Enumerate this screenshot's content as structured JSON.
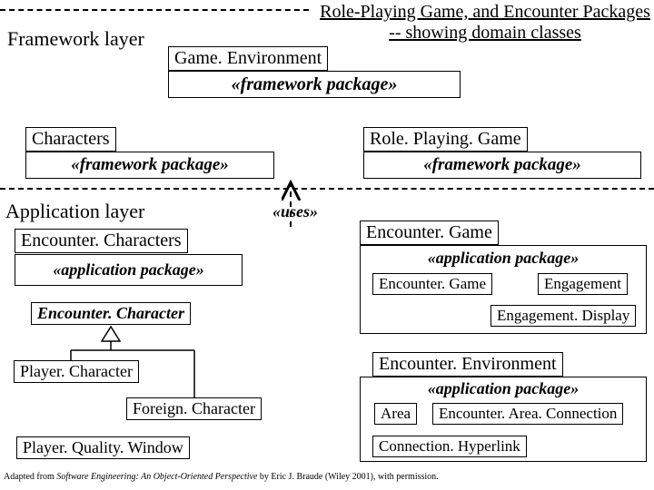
{
  "header": {
    "title_line1": "Role-Playing Game, and Encounter Packages",
    "title_line2": "-- showing domain classes"
  },
  "layers": {
    "framework": "Framework layer",
    "application": "Application layer"
  },
  "stereotypes": {
    "framework": "«framework package»",
    "application": "«application package»",
    "uses": "«uses»"
  },
  "packages": {
    "game_environment": "Game. Environment",
    "characters": "Characters",
    "role_playing_game": "Role. Playing. Game",
    "encounter_characters": "Encounter. Characters",
    "encounter_game": "Encounter. Game",
    "encounter_environment": "Encounter. Environment"
  },
  "classes": {
    "encounter_character": "Encounter. Character",
    "player_character": "Player. Character",
    "foreign_character": "Foreign. Character",
    "player_quality_window": "Player. Quality. Window",
    "encounter_game_inner": "Encounter. Game",
    "engagement": "Engagement",
    "engagement_display": "Engagement. Display",
    "area": "Area",
    "encounter_area_connection": "Encounter. Area. Connection",
    "connection_hyperlink": "Connection. Hyperlink"
  },
  "footnote": {
    "prefix": "Adapted from ",
    "book": "Software Engineering: An Object-Oriented Perspective",
    "suffix": " by Eric J. Braude (Wiley 2001), with permission."
  }
}
